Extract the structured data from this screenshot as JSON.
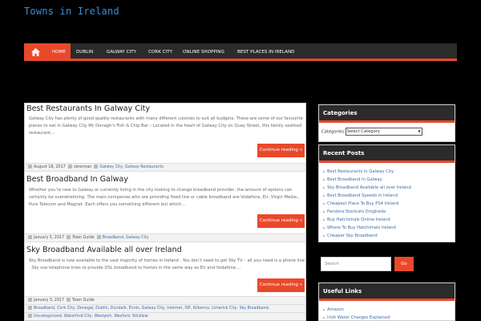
{
  "site": {
    "title": "Towns in Ireland"
  },
  "nav": {
    "items": [
      {
        "label": "Home",
        "active": true
      },
      {
        "label": "Dublin"
      },
      {
        "label": "Galway City"
      },
      {
        "label": "Cork City"
      },
      {
        "label": "Online Shopping"
      },
      {
        "label": "Best Places in Ireland"
      }
    ]
  },
  "posts": [
    {
      "title": "Best Restaurants In Galway City",
      "excerpt": "Galway City has plenty of good quality restaurants with many different cuisines to suit all budgets. These are some of our favourite places to eat in Galway City Mc Donagh’s Fish & Chip Bar – Located in the heart of Galway City on Quay Street, this family seafood restaurant…",
      "read_more": "Continue reading »",
      "date": "August 18, 2017",
      "author": "cbrennan",
      "categories": "Galway City, Galway Restaurants"
    },
    {
      "title": "Best Broadband In Galway",
      "excerpt": "Whether you’re new to Galway or currently living in the city looking to change broadband provider, the amount of options can certainly be overwhelming. The main companies who are providing fixed line or cable broadband are Vodafone, Eir, Virgin Media , Pure Telecom and Magnet. Each offers you something different but which…",
      "read_more": "Continue reading »",
      "date": "January 5, 2017",
      "author": "Town Guide",
      "categories": "Broadband, Galway City"
    },
    {
      "title": "Sky Broadband Available all over Ireland",
      "excerpt": "Sky Broadband is now available to the vast majority of homes in Ireland . You don’t need to get Sky TV – all you need is a phone line . Sky use telephone lines to provide DSL broadband to homes in the same way as Eir and Vodafone.…",
      "read_more": "Continue reading »",
      "date": "January 3, 2017",
      "author": "Town Guide",
      "categories": "Broadband, Cork City, Donegal, Dublin, Dundalk, Ennis, Galway City, Internet, ISP, Kilkenny, Limerick City, Sky Broadband,",
      "categories2": "Uncategorized, Waterford City, Westport, Wexford, Wicklow"
    }
  ],
  "sidebar": {
    "categories": {
      "heading": "Categories",
      "label": "Categories",
      "select_value": "Select Category"
    },
    "recent": {
      "heading": "Recent Posts",
      "items": [
        "Best Restaurants In Galway City",
        "Best Broadband In Galway",
        "Sky Broadband Available all over Ireland",
        "Best Broadband Speeds in Ireland",
        "Cheapest Place To Buy PS4 Ireland",
        "Pandora Stockists Drogheda",
        "Buy Hatchimals Online Ireland",
        "Where To Buy Hatchimals Ireland",
        "Cheaper Sky Broadband"
      ]
    },
    "search": {
      "placeholder": "Search",
      "button": "Go"
    },
    "useful": {
      "heading": "Useful Links",
      "items": [
        "Amazon",
        "Irish Water Charges Explained"
      ]
    }
  },
  "colors": {
    "accent": "#e9492b",
    "link": "#3b6ea8",
    "title": "#3b8ed8"
  }
}
